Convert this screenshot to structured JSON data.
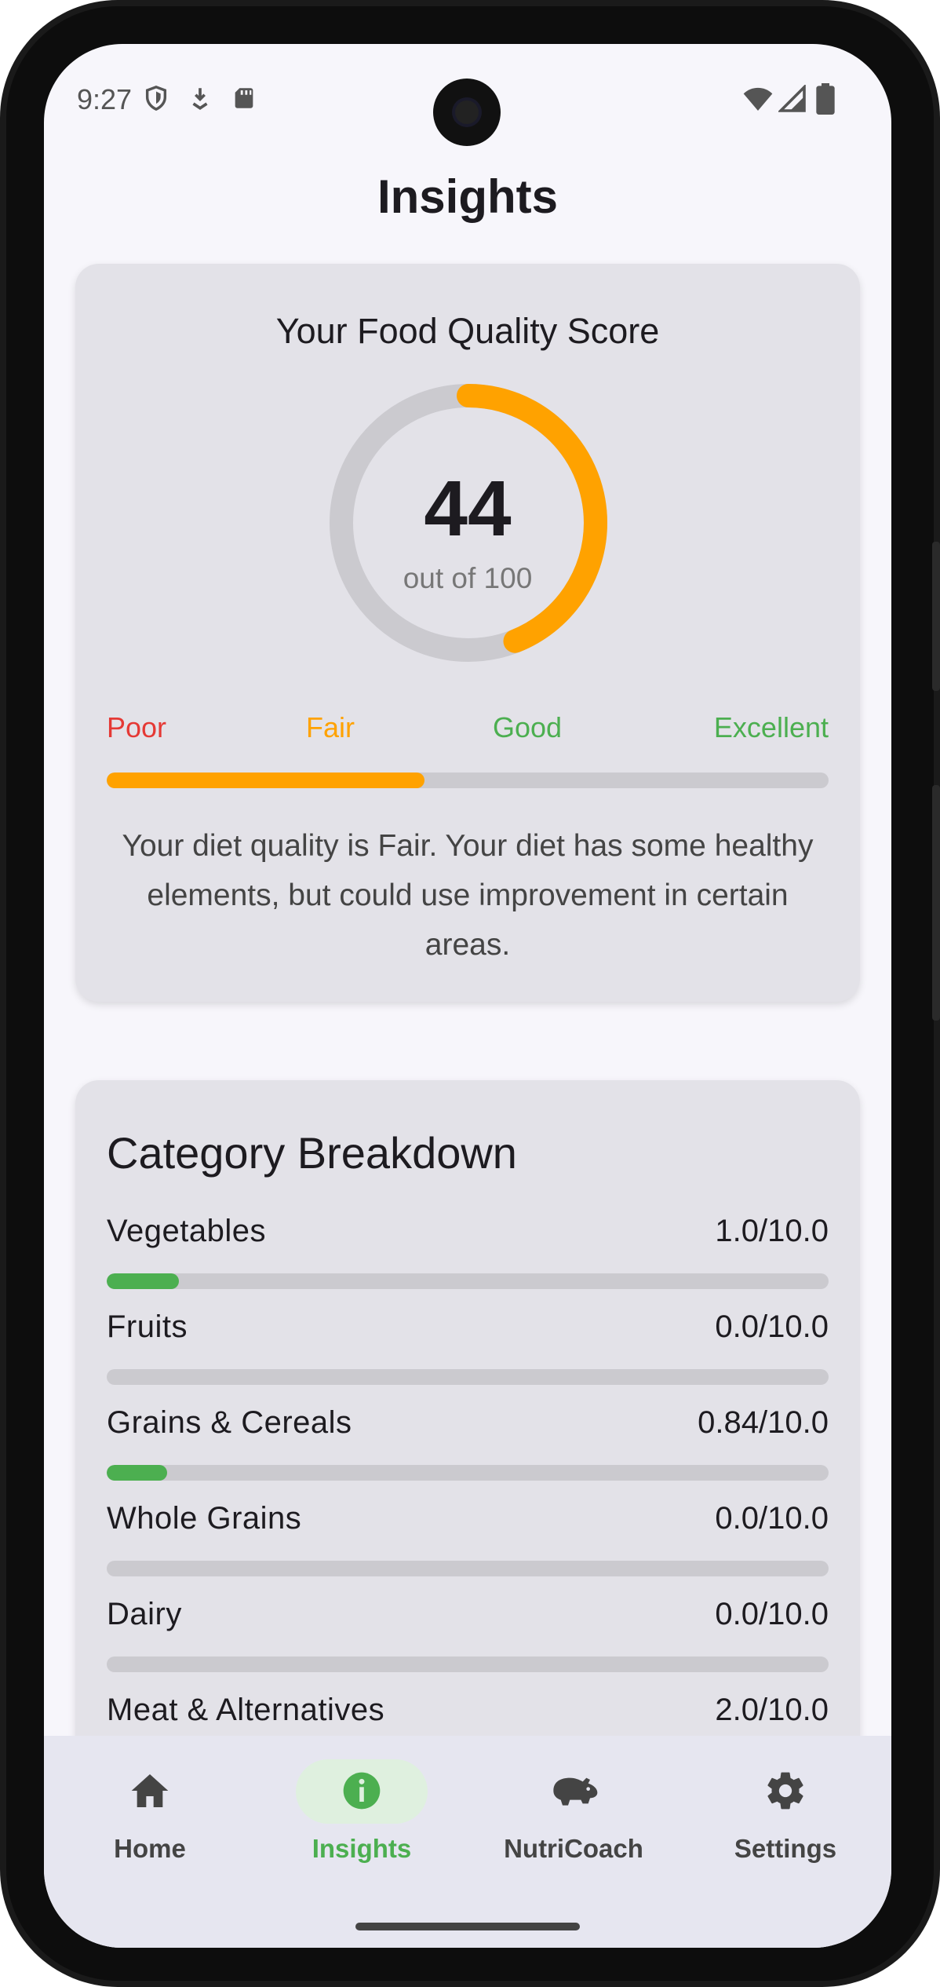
{
  "status_bar": {
    "time": "9:27"
  },
  "page": {
    "title": "Insights"
  },
  "score_card": {
    "heading": "Your Food Quality Score",
    "score": "44",
    "score_fraction": 0.44,
    "sub": "out of 100",
    "scale": [
      "Poor",
      "Fair",
      "Good",
      "Excellent"
    ],
    "scale_colors": [
      "#e53935",
      "#ffa200",
      "#4caf50",
      "#4caf50"
    ],
    "accent_color": "#ffa200",
    "description": "Your diet quality is Fair. Your diet has some healthy elements, but could use improvement in certain areas."
  },
  "category_card": {
    "title": "Category Breakdown",
    "items": [
      {
        "name": "Vegetables",
        "value": "1.0/10.0",
        "fraction": 0.1
      },
      {
        "name": "Fruits",
        "value": "0.0/10.0",
        "fraction": 0.0
      },
      {
        "name": "Grains & Cereals",
        "value": "0.84/10.0",
        "fraction": 0.084
      },
      {
        "name": "Whole Grains",
        "value": "0.0/10.0",
        "fraction": 0.0
      },
      {
        "name": "Dairy",
        "value": "0.0/10.0",
        "fraction": 0.0
      },
      {
        "name": "Meat & Alternatives",
        "value": "2.0/10.0",
        "fraction": 0.2
      }
    ]
  },
  "bottom_nav": {
    "items": [
      {
        "label": "Home",
        "icon": "home-icon",
        "active": false
      },
      {
        "label": "Insights",
        "icon": "info-icon",
        "active": true
      },
      {
        "label": "NutriCoach",
        "icon": "hippo-icon",
        "active": false
      },
      {
        "label": "Settings",
        "icon": "gear-icon",
        "active": false
      }
    ],
    "active_color": "#4caf50",
    "active_pill_color": "#dff0df"
  }
}
